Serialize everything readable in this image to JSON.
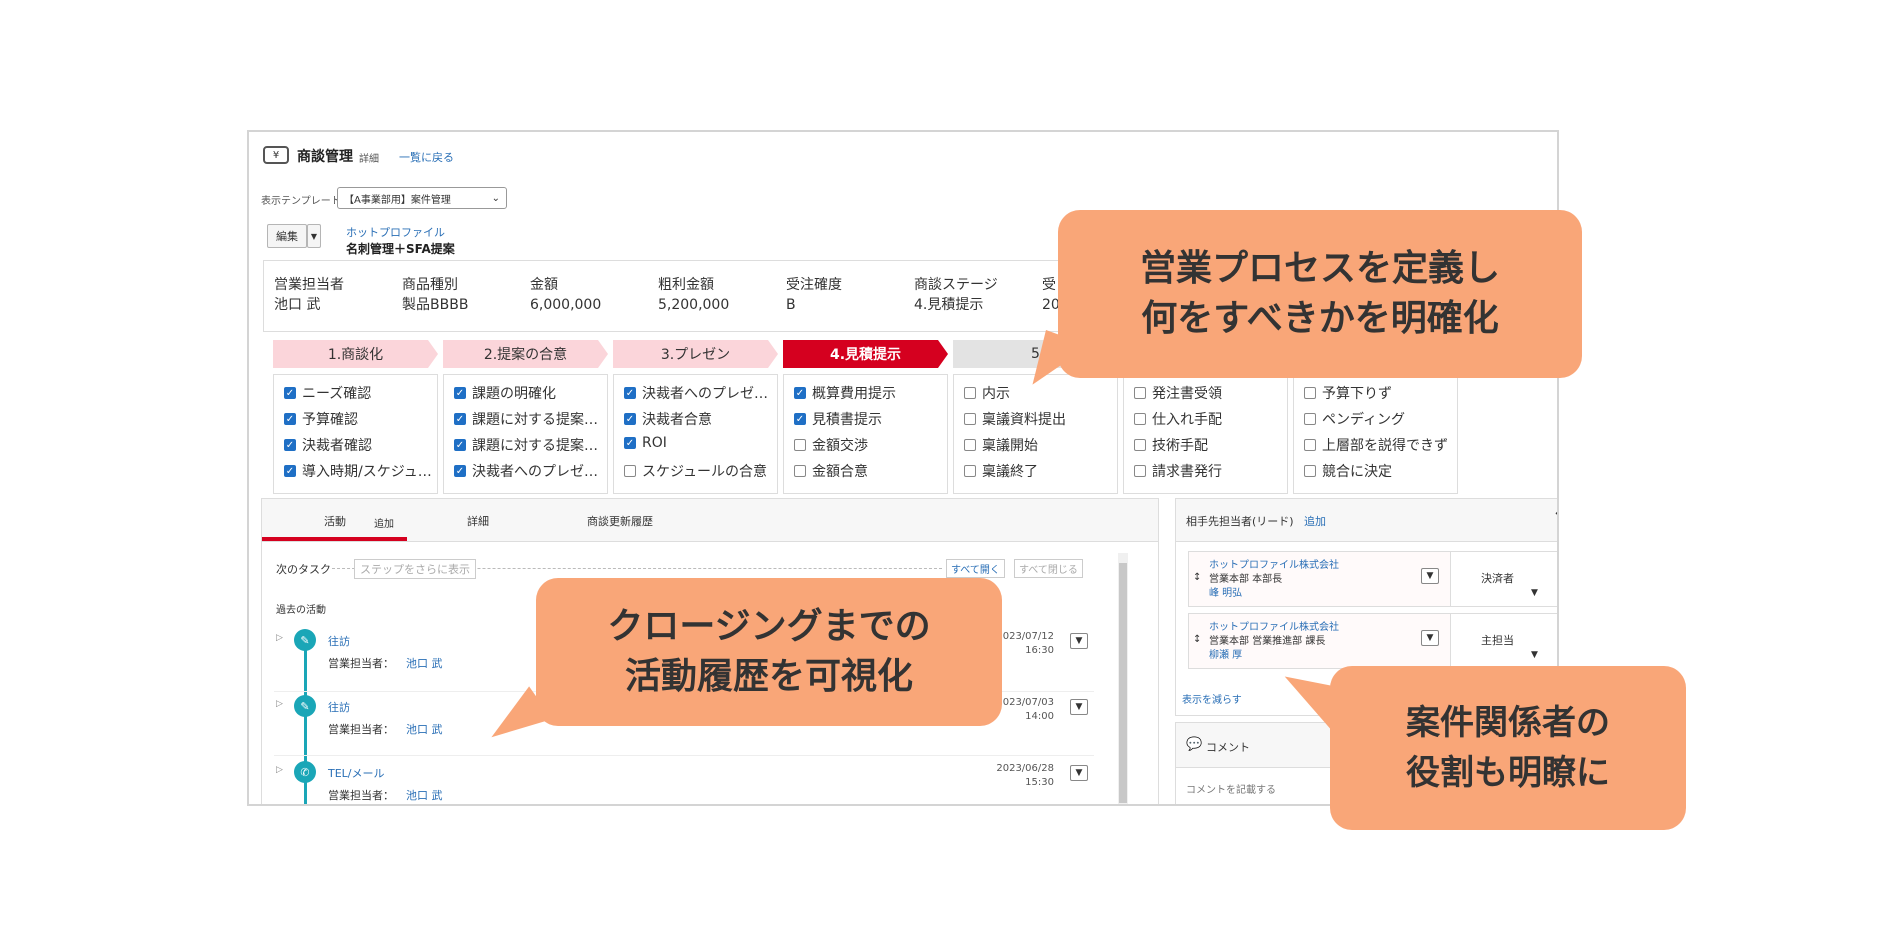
{
  "header": {
    "module_title": "商談管理",
    "sub_title": "詳細",
    "back_link": "一覧に戻る",
    "template_label": "表示テンプレート",
    "template_value": "【A事業部用】案件管理",
    "edit_button": "編集",
    "company_link": "ホットプロファイル",
    "deal_name": "名刺管理＋SFA提案"
  },
  "summary": [
    {
      "label": "営業担当者",
      "value": "池口 武"
    },
    {
      "label": "商品種別",
      "value": "製品BBBB"
    },
    {
      "label": "金額",
      "value": "6,000,000"
    },
    {
      "label": "粗利金額",
      "value": "5,200,000"
    },
    {
      "label": "受注確度",
      "value": "B"
    },
    {
      "label": "商談ステージ",
      "value": "4.見積提示"
    },
    {
      "label": "受",
      "value": "20"
    }
  ],
  "stages": [
    {
      "label": "1.商談化"
    },
    {
      "label": "2.提案の合意"
    },
    {
      "label": "3.プレゼン"
    },
    {
      "label": "4.見積提示"
    },
    {
      "label": "5"
    }
  ],
  "checklists": [
    [
      {
        "label": "ニーズ確認",
        "checked": true
      },
      {
        "label": "予算確認",
        "checked": true
      },
      {
        "label": "決裁者確認",
        "checked": true
      },
      {
        "label": "導入時期/スケジュ…",
        "checked": true
      }
    ],
    [
      {
        "label": "課題の明確化",
        "checked": true
      },
      {
        "label": "課題に対する提案…",
        "checked": true
      },
      {
        "label": "課題に対する提案…",
        "checked": true
      },
      {
        "label": "決裁者へのプレゼ…",
        "checked": true
      }
    ],
    [
      {
        "label": "決裁者へのプレゼ…",
        "checked": true
      },
      {
        "label": "決裁者合意",
        "checked": true
      },
      {
        "label": "ROI",
        "checked": true
      },
      {
        "label": "スケジュールの合意",
        "checked": false
      }
    ],
    [
      {
        "label": "概算費用提示",
        "checked": true
      },
      {
        "label": "見積書提示",
        "checked": true
      },
      {
        "label": "金額交渉",
        "checked": false
      },
      {
        "label": "金額合意",
        "checked": false
      }
    ],
    [
      {
        "label": "内示",
        "checked": false
      },
      {
        "label": "稟議資料提出",
        "checked": false
      },
      {
        "label": "稟議開始",
        "checked": false
      },
      {
        "label": "稟議終了",
        "checked": false
      }
    ],
    [
      {
        "label": "発注書受領",
        "checked": false
      },
      {
        "label": "仕入れ手配",
        "checked": false
      },
      {
        "label": "技術手配",
        "checked": false
      },
      {
        "label": "請求書発行",
        "checked": false
      }
    ],
    [
      {
        "label": "予算下りず",
        "checked": false
      },
      {
        "label": "ペンディング",
        "checked": false
      },
      {
        "label": "上層部を説得できず",
        "checked": false
      },
      {
        "label": "競合に決定",
        "checked": false
      }
    ]
  ],
  "activity_panel": {
    "tabs": [
      {
        "label": "活動",
        "add": "追加"
      },
      {
        "label": "詳細"
      },
      {
        "label": "商談更新履歴"
      }
    ],
    "next_task_label": "次のタスク",
    "show_steps": "ステップをさらに表示",
    "open_all": "すべて開く",
    "close_all": "すべて閉じる",
    "past_label": "過去の活動",
    "activities": [
      {
        "type": "往訪",
        "owner_label": "営業担当者：",
        "owner": "池口 武",
        "date": "2023/07/12",
        "time": "16:30"
      },
      {
        "type": "往訪",
        "owner_label": "営業担当者：",
        "owner": "池口 武",
        "date": "2023/07/03",
        "time": "14:00"
      },
      {
        "type": "TEL/メール",
        "owner_label": "営業担当者：",
        "owner": "池口 武",
        "date": "2023/06/28",
        "time": "15:30"
      }
    ]
  },
  "contacts_panel": {
    "title": "相手先担当者(リード)",
    "add": "追加",
    "contacts": [
      {
        "company": "ホットプロファイル株式会社",
        "dept": "営業本部 本部長",
        "name": "峰 明弘",
        "role": "決済者"
      },
      {
        "company": "ホットプロファイル株式会社",
        "dept": "営業本部 営業推進部 課長",
        "name": "柳瀬 厚",
        "role": "主担当"
      }
    ],
    "show_less": "表示を減らす"
  },
  "comment_panel": {
    "title": "コメント",
    "placeholder": "コメントを記載する"
  },
  "callouts": {
    "process": [
      "営業プロセスを定義し",
      "何をすべきかを明確化"
    ],
    "history": [
      "クロージングまでの",
      "活動履歴を可視化"
    ],
    "roles": [
      "案件関係者の",
      "役割も明瞭に"
    ]
  },
  "colors": {
    "accent_red": "#d5001f",
    "stage_pink": "#fbd5da",
    "link_blue": "#2a6fb6",
    "timeline_teal": "#1aa6b7",
    "callout_orange": "#f9a678"
  }
}
